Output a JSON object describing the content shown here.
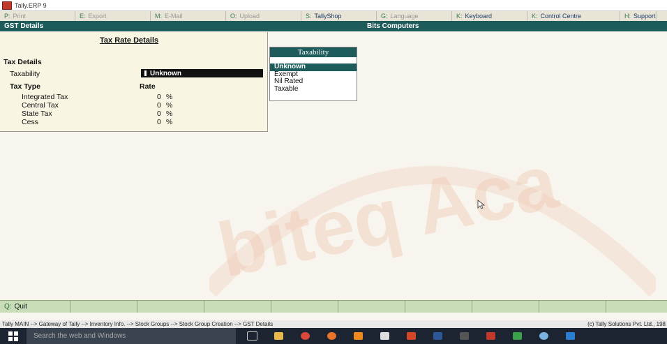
{
  "window": {
    "title": "Tally.ERP 9"
  },
  "buttonbar": {
    "items": [
      {
        "key": "P:",
        "label": "Print",
        "active": false
      },
      {
        "key": "E:",
        "label": "Export",
        "active": false
      },
      {
        "key": "M:",
        "label": "E-Mail",
        "active": false
      },
      {
        "key": "O:",
        "label": "Upload",
        "active": false
      },
      {
        "key": "S:",
        "label": "TallyShop",
        "active": true
      },
      {
        "key": "G:",
        "label": "Language",
        "active": false
      },
      {
        "key": "K:",
        "label": "Keyboard",
        "active": true
      },
      {
        "key": "K:",
        "label": "Control Centre",
        "active": true
      },
      {
        "key": "H:",
        "label": "Support",
        "active": true
      }
    ]
  },
  "header": {
    "left": "GST Details",
    "center": "Bits Computers"
  },
  "panel": {
    "title": "Tax Rate Details",
    "section": "Tax Details",
    "taxability_label": "Taxability",
    "taxability_value": "Unknown",
    "tax_type_header": "Tax Type",
    "rate_header": "Rate",
    "rows": [
      {
        "type": "Integrated Tax",
        "rate": "0",
        "unit": "%"
      },
      {
        "type": "Central Tax",
        "rate": "0",
        "unit": "%"
      },
      {
        "type": "State Tax",
        "rate": "0",
        "unit": "%"
      },
      {
        "type": "Cess",
        "rate": "0",
        "unit": "%"
      }
    ]
  },
  "popup": {
    "title": "Taxability",
    "options": [
      "Unknown",
      "Exempt",
      "Nil Rated",
      "Taxable"
    ],
    "selected": "Unknown"
  },
  "bottombar": {
    "quit_key": "Q:",
    "quit_label": "Quit"
  },
  "statusbar": {
    "path": "Tally MAIN --> Gateway of Tally --> Inventory Info. --> Stock Groups --> Stock Group Creation --> GST Details",
    "copyright": "(c) Tally Solutions Pvt. Ltd., 198"
  },
  "taskbar": {
    "search_placeholder": "Search the web and Windows"
  },
  "watermark": "biteq Aca",
  "colors": {
    "accent": "#1e5b5b",
    "panel_bg": "#f8f5e2",
    "bottombar_bg": "#c9ddb9"
  }
}
